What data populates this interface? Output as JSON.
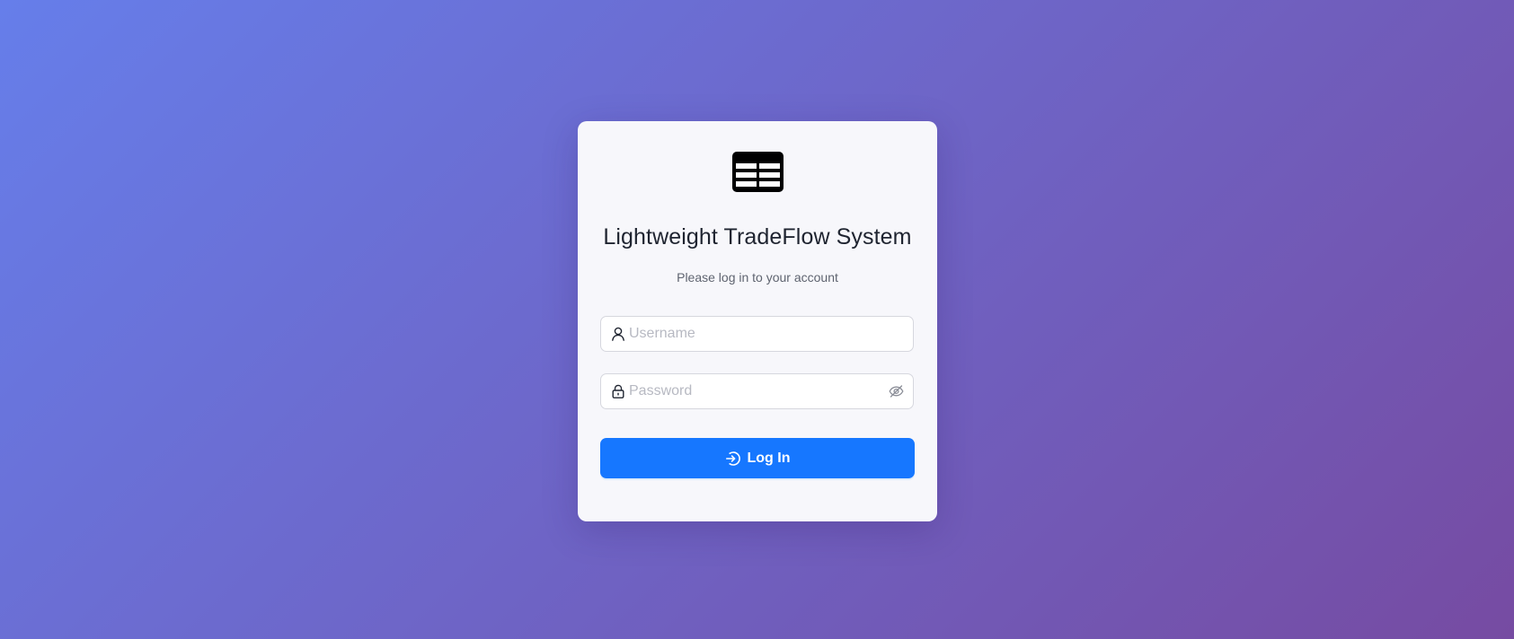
{
  "app": {
    "logo_icon": "table-icon",
    "title": "Lightweight TradeFlow System",
    "subtitle": "Please log in to your account"
  },
  "form": {
    "username": {
      "placeholder": "Username",
      "value": "",
      "icon": "user-icon"
    },
    "password": {
      "placeholder": "Password",
      "value": "",
      "icon": "lock-icon",
      "toggle_icon": "eye-invisible-icon"
    },
    "submit": {
      "label": "Log In",
      "icon": "login-icon"
    }
  },
  "colors": {
    "background_start": "#667eea",
    "background_end": "#764ba2",
    "card": "#f7f7fb",
    "primary": "#1677ff",
    "title_text": "#1f2430",
    "subtitle_text": "#5f6470"
  }
}
